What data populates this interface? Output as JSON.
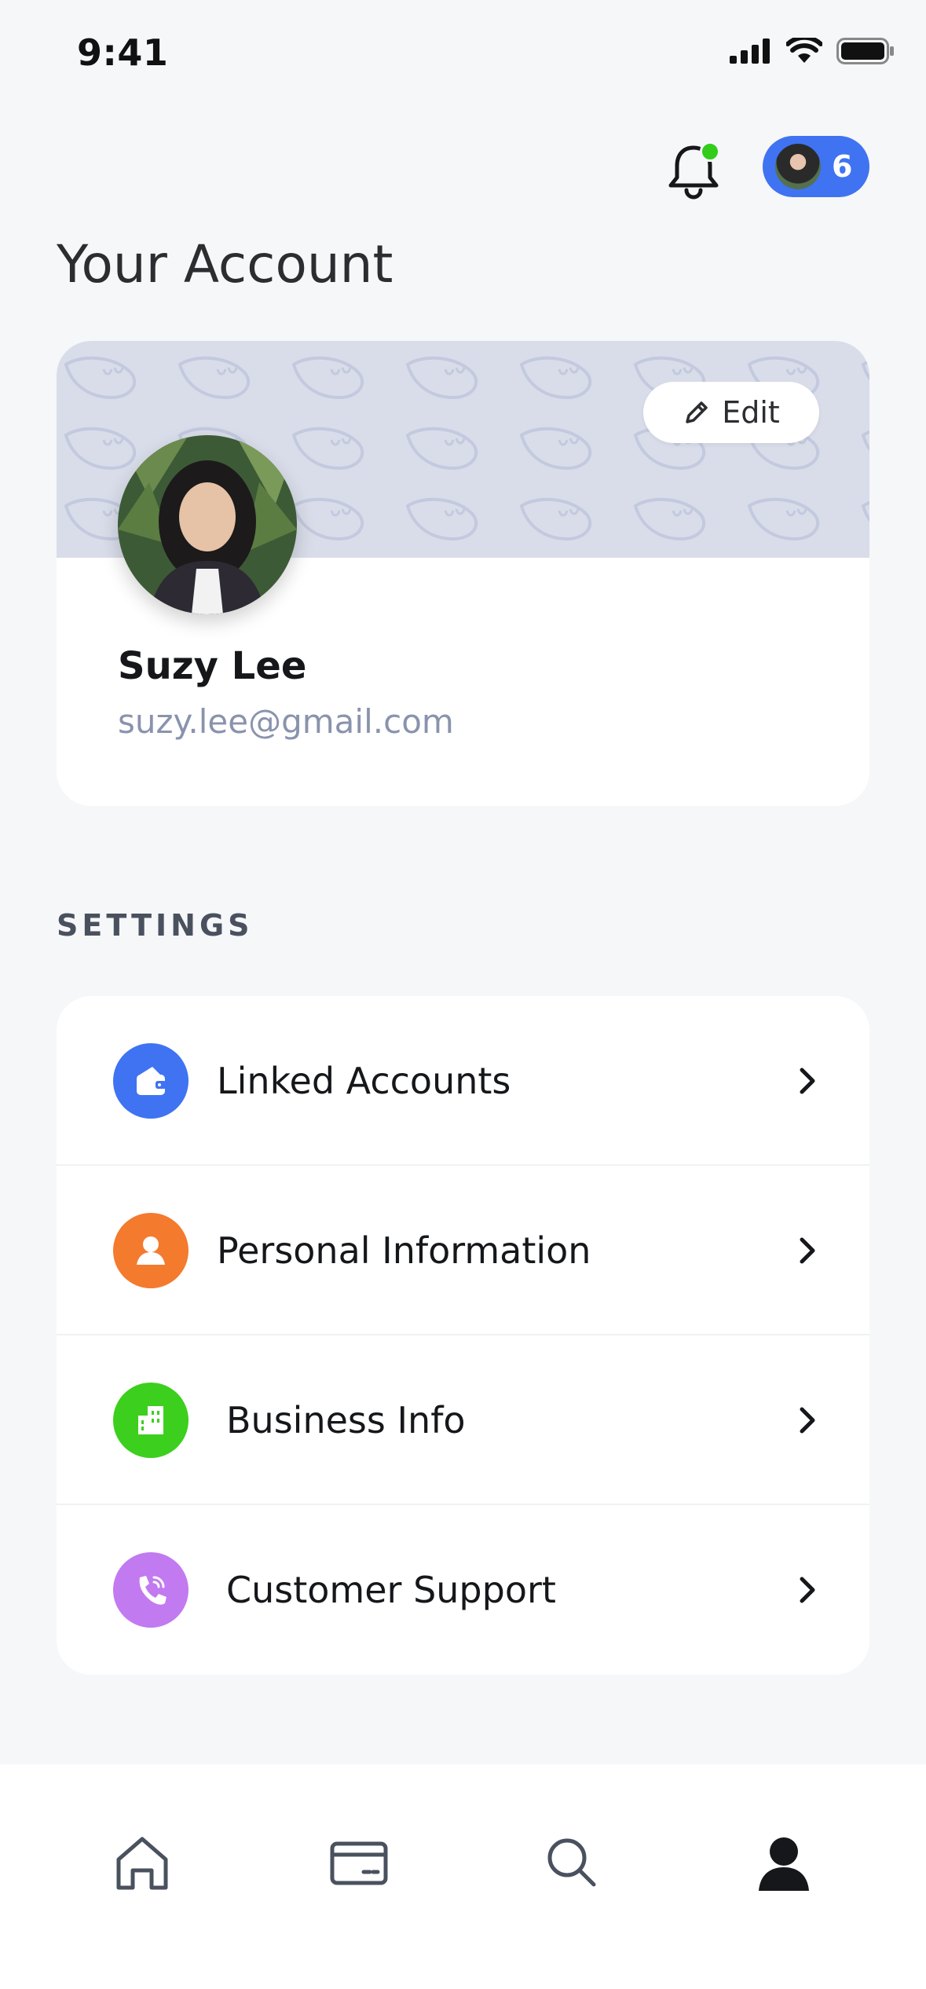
{
  "status_bar": {
    "time": "9:41"
  },
  "header": {
    "notification_count": "6"
  },
  "page": {
    "title": "Your Account"
  },
  "profile": {
    "edit_label": "Edit",
    "name": "Suzy Lee",
    "email": "suzy.lee@gmail.com"
  },
  "settings": {
    "section_label": "SETTINGS",
    "items": [
      {
        "label": "Linked Accounts",
        "icon": "wallet-icon",
        "color": "#3f73f2"
      },
      {
        "label": "Personal Information",
        "icon": "person-icon",
        "color": "#f47a2e"
      },
      {
        "label": "Business Info",
        "icon": "building-icon",
        "color": "#3ccf1d"
      },
      {
        "label": "Customer Support",
        "icon": "phone-icon",
        "color": "#c27af0"
      }
    ]
  },
  "tab_bar": {
    "tabs": [
      {
        "icon": "home-icon"
      },
      {
        "icon": "card-icon"
      },
      {
        "icon": "search-icon"
      },
      {
        "icon": "profile-icon",
        "active": true
      }
    ]
  }
}
